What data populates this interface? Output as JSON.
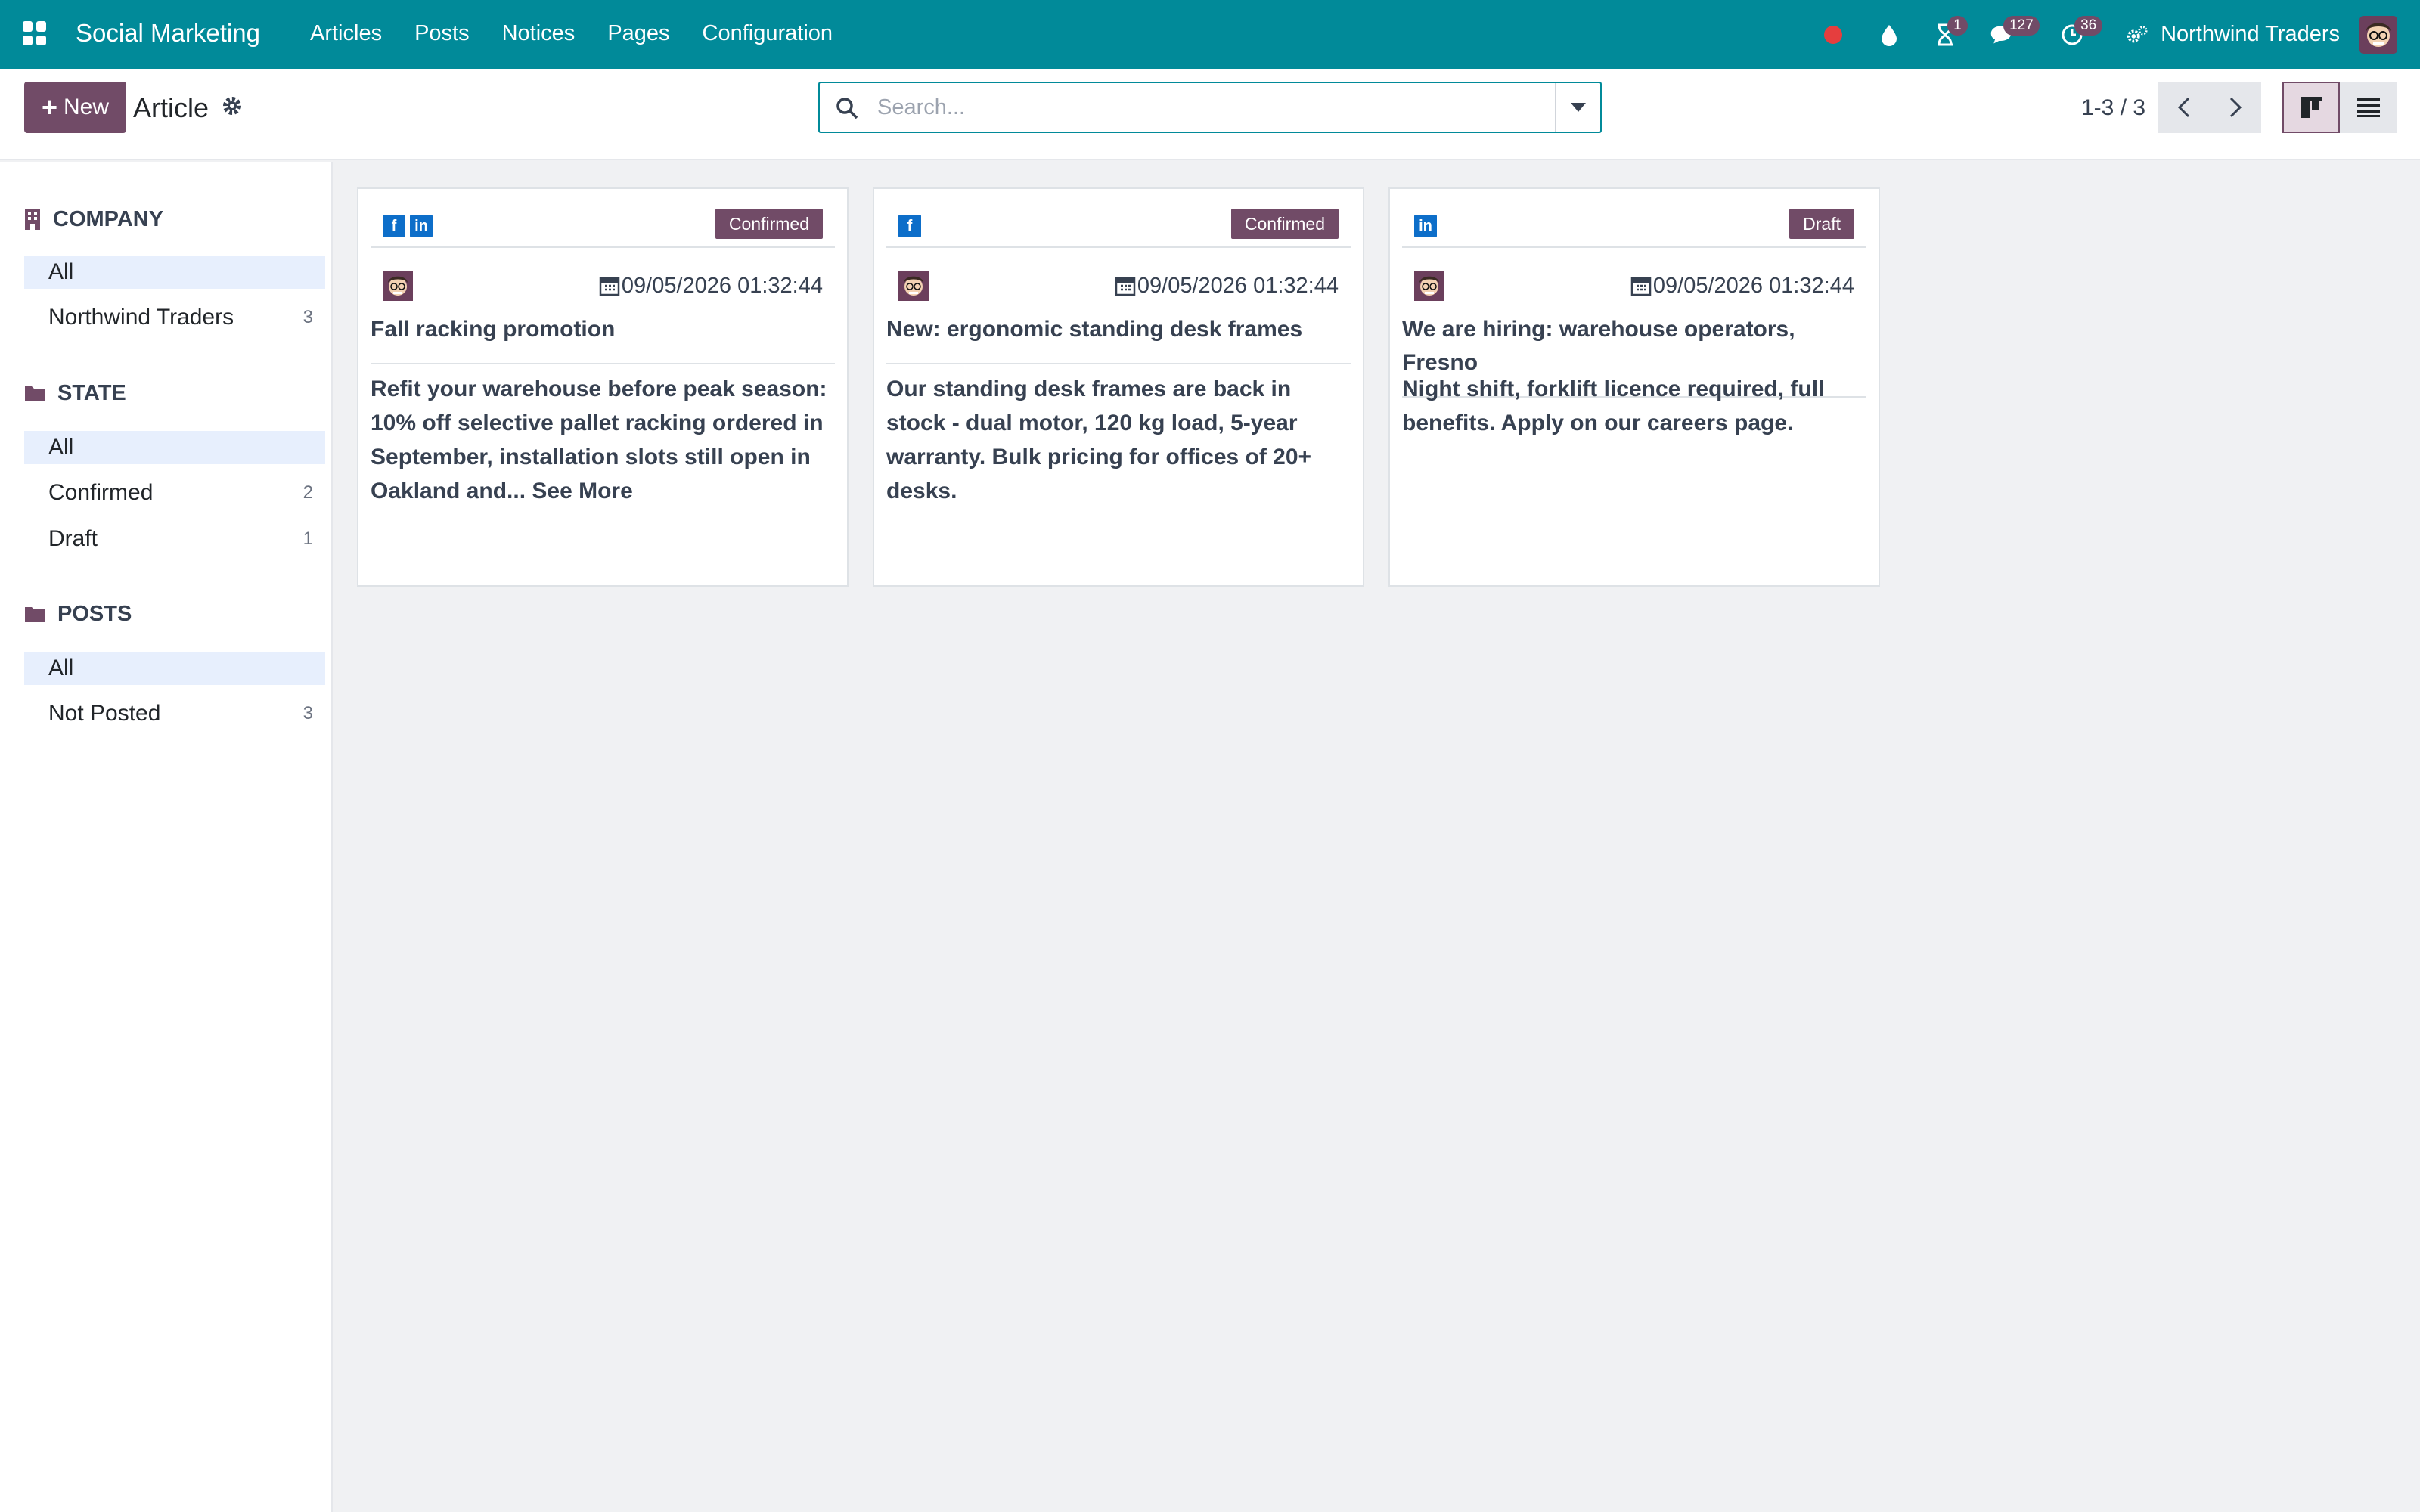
{
  "navbar": {
    "brand": "Social Marketing",
    "menu": [
      "Articles",
      "Posts",
      "Notices",
      "Pages",
      "Configuration"
    ],
    "activity_badge": "1",
    "messages_badge": "127",
    "clock_badge": "36",
    "company": "Northwind Traders",
    "colors": {
      "bar": "#018a99",
      "badge": "#714b67",
      "recording_dot": "#e53e3e"
    }
  },
  "control": {
    "new_label": "New",
    "breadcrumb": "Article",
    "search_placeholder": "Search...",
    "pager": "1-3 / 3"
  },
  "sidebar": {
    "company": {
      "title": "COMPANY",
      "items": [
        {
          "label": "All",
          "count": ""
        },
        {
          "label": "Northwind Traders",
          "count": "3"
        }
      ]
    },
    "state": {
      "title": "STATE",
      "items": [
        {
          "label": "All",
          "count": ""
        },
        {
          "label": "Confirmed",
          "count": "2"
        },
        {
          "label": "Draft",
          "count": "1"
        }
      ]
    },
    "posts": {
      "title": "POSTS",
      "items": [
        {
          "label": "All",
          "count": ""
        },
        {
          "label": "Not Posted",
          "count": "3"
        }
      ]
    }
  },
  "cards": [
    {
      "state": "Confirmed",
      "date": "09/05/2026 01:32:44",
      "title": "Fall racking promotion",
      "body": "Refit your warehouse before peak season: 10% off selective pallet racking ordered in September, installation slots still open in Oakland and...",
      "see_more": "See More"
    },
    {
      "state": "Confirmed",
      "date": "09/05/2026 01:32:44",
      "title": "New: ergonomic standing desk frames",
      "body": "Our standing desk frames are back in stock - dual motor, 120 kg load, 5-year warranty. Bulk pricing for offices of 20+ desks."
    },
    {
      "state": "Draft",
      "date": "09/05/2026 01:32:44",
      "title": "We are hiring: warehouse operators, Fresno",
      "body": "Night shift, forklift licence required, full benefits. Apply on our careers page."
    }
  ]
}
